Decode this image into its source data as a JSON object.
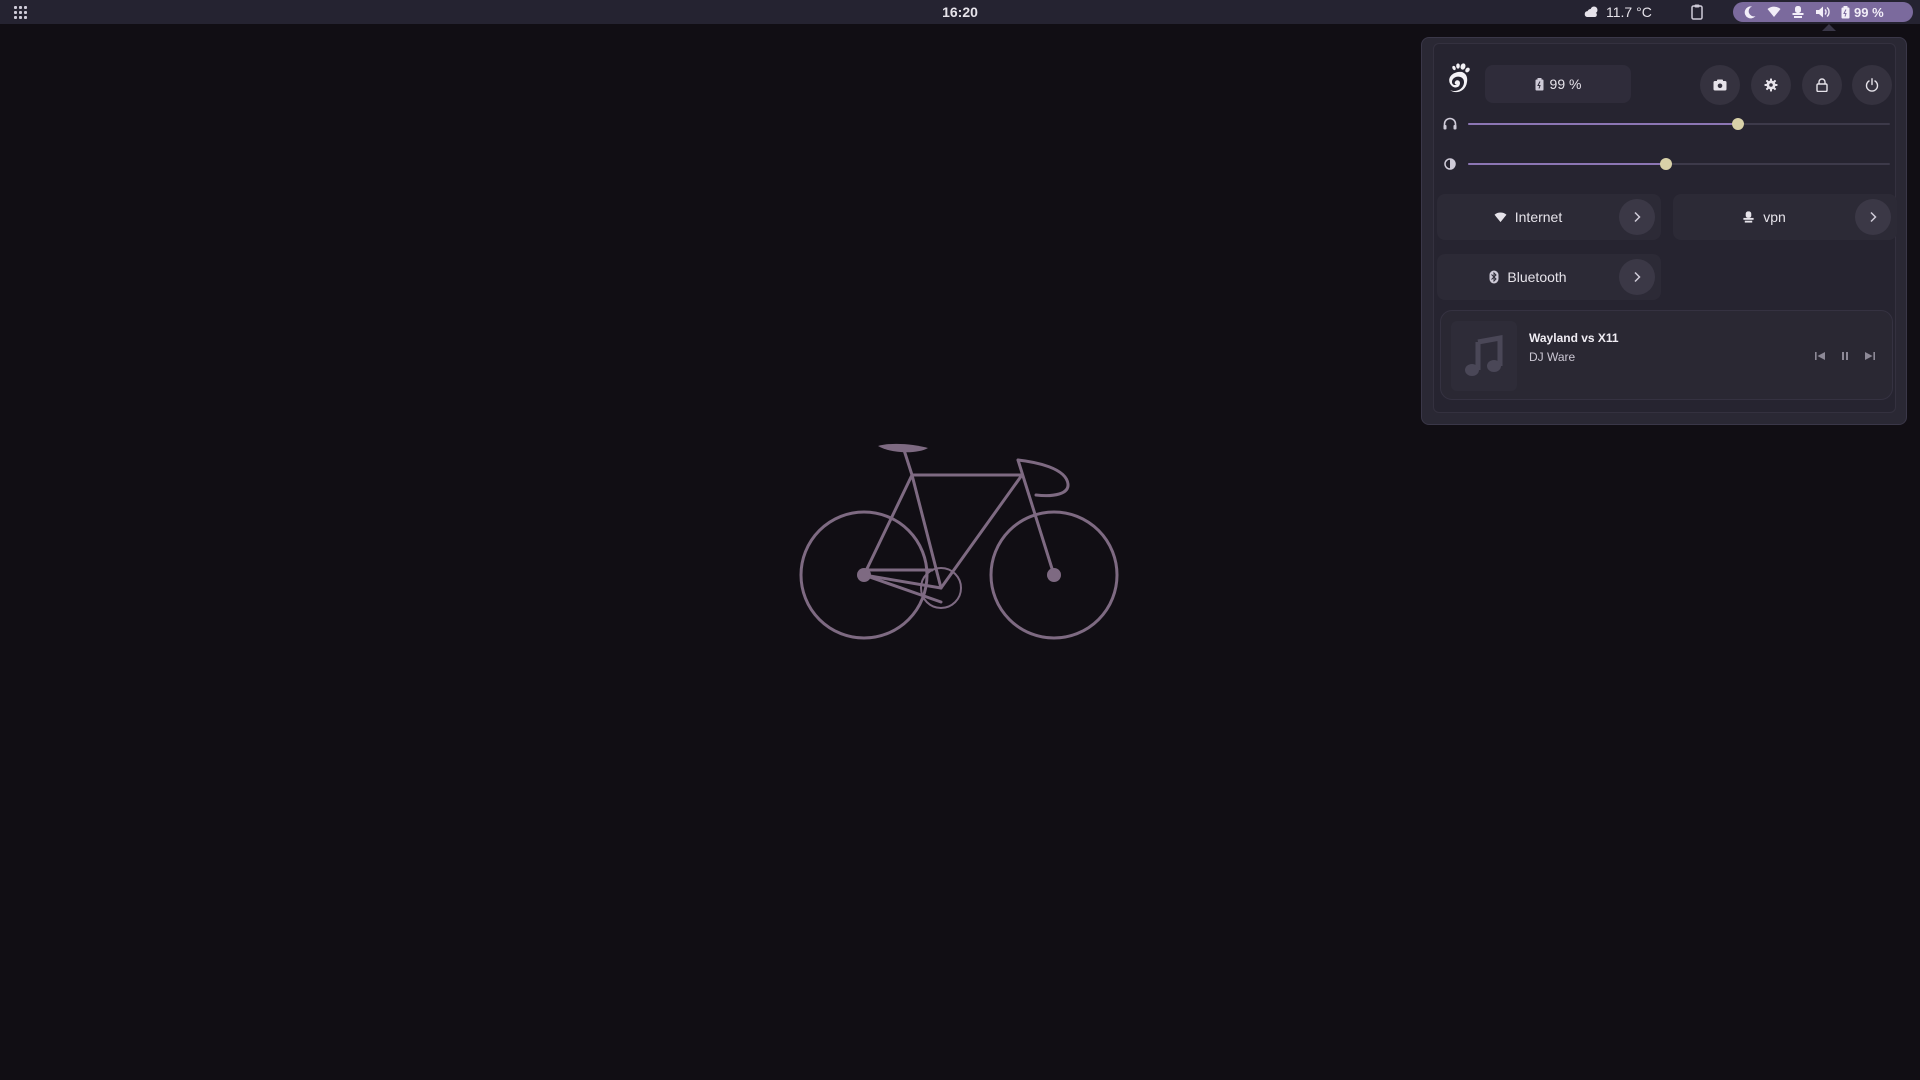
{
  "topbar": {
    "clock": "16:20",
    "weather": {
      "icon": "cloud-sun-icon",
      "temperature": "11.7 °C"
    },
    "tray": {
      "battery_label": "99 %"
    }
  },
  "panel": {
    "battery_label": "99 %",
    "sliders": {
      "volume": {
        "icon": "headphones-icon",
        "level": 0.64
      },
      "brightness": {
        "icon": "brightness-icon",
        "level": 0.47
      }
    },
    "toggles": {
      "internet": "Internet",
      "vpn": "vpn",
      "bluetooth": "Bluetooth"
    },
    "media": {
      "title": "Wayland vs X11",
      "artist": "DJ Ware"
    }
  },
  "colors": {
    "accent": "#8c76b4",
    "tray": "#7b6a9d",
    "knob": "#d8d1a8",
    "desktop": "#110e14",
    "bike": "#7e6a82"
  }
}
